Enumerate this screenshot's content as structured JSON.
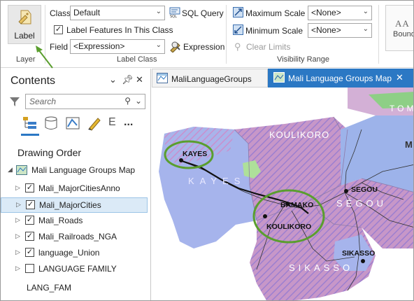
{
  "ribbon": {
    "layer_group": {
      "label_button": "Label",
      "group_label": "Layer"
    },
    "label_class": {
      "class_label": "Class",
      "class_value": "Default",
      "sql_query": "SQL Query",
      "label_features_checkbox": "Label Features In This Class",
      "field_label": "Field",
      "field_value": "<Expression>",
      "expression_button": "Expression",
      "group_label": "Label Class"
    },
    "visibility_range": {
      "max_scale_label": "Maximum Scale",
      "max_scale_value": "<None>",
      "min_scale_label": "Minimum Scale",
      "min_scale_value": "<None>",
      "clear_limits": "Clear Limits",
      "group_label": "Visibility Range"
    },
    "symbol_gallery": {
      "preview_text": "AA",
      "preview_caption": "Bound"
    }
  },
  "contents": {
    "title": "Contents",
    "search_placeholder": "Search",
    "drawing_order": "Drawing Order",
    "map_name": "Mali Language Groups Map",
    "layers": [
      {
        "name": "Mali_MajorCitiesAnno",
        "checked": true
      },
      {
        "name": "Mali_MajorCities",
        "checked": true,
        "selected": true
      },
      {
        "name": "Mali_Roads",
        "checked": true
      },
      {
        "name": "Mali_Railroads_NGA",
        "checked": true
      },
      {
        "name": "language_Union",
        "checked": true
      },
      {
        "name": "LANGUAGE FAMILY",
        "checked": false
      }
    ],
    "legend_heading": "LANG_FAM",
    "more_glyph": "...",
    "tab_cut_glyph": "E"
  },
  "tabs": [
    {
      "label": "MaliLanguageGroups",
      "active": false
    },
    {
      "label": "Mali Language Groups Map",
      "active": true
    }
  ],
  "map": {
    "region_labels": [
      "KOULIKORO",
      "KAYES",
      "SÉGOU",
      "SIKASSO"
    ],
    "edge_labels": [
      "TOM",
      "M"
    ],
    "city_labels": [
      "KAYES",
      "BAMAKO",
      "KOULIKORO",
      "SEGOU",
      "SIKASSO"
    ]
  },
  "colors": {
    "accent": "#2b78c4",
    "highlight_circle": "#5a9e2e",
    "arrow": "#5a9e2e"
  }
}
